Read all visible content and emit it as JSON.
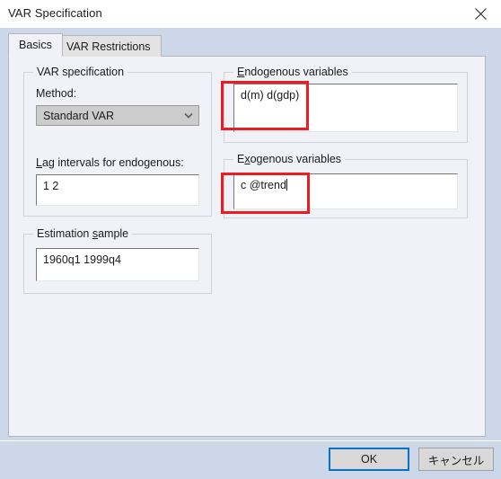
{
  "window": {
    "title": "VAR Specification",
    "close_icon": "close-icon"
  },
  "tabs": [
    {
      "label": "Basics",
      "active": true
    },
    {
      "label": "VAR Restrictions",
      "active": false
    }
  ],
  "groups": {
    "var_specification": {
      "legend": "VAR specification",
      "method_label": "Method:",
      "method_value": "Standard VAR",
      "method_arrow_icon": "chevron-down-icon",
      "lag_label": "Lag intervals for endogenous:",
      "lag_value": "1 2"
    },
    "estimation_sample": {
      "legend": "Estimation sample",
      "value": "1960q1 1999q4"
    },
    "endogenous": {
      "legend": "Endogenous variables",
      "value": "d(m) d(gdp)"
    },
    "exogenous": {
      "legend": "Exogenous variables",
      "value": "c @trend"
    }
  },
  "annotations": [
    {
      "name": "endogenous-highlight",
      "color": "#ec1c23"
    },
    {
      "name": "exogenous-highlight",
      "color": "#ec1c23"
    }
  ],
  "footer": {
    "ok_label": "OK",
    "cancel_label": "キャンセル"
  },
  "colors": {
    "accent": "#0a72c4",
    "annotation": "#ec1c23",
    "dialog_bg": "#f0f2f7",
    "chrome_bg": "#ccd7ea"
  }
}
